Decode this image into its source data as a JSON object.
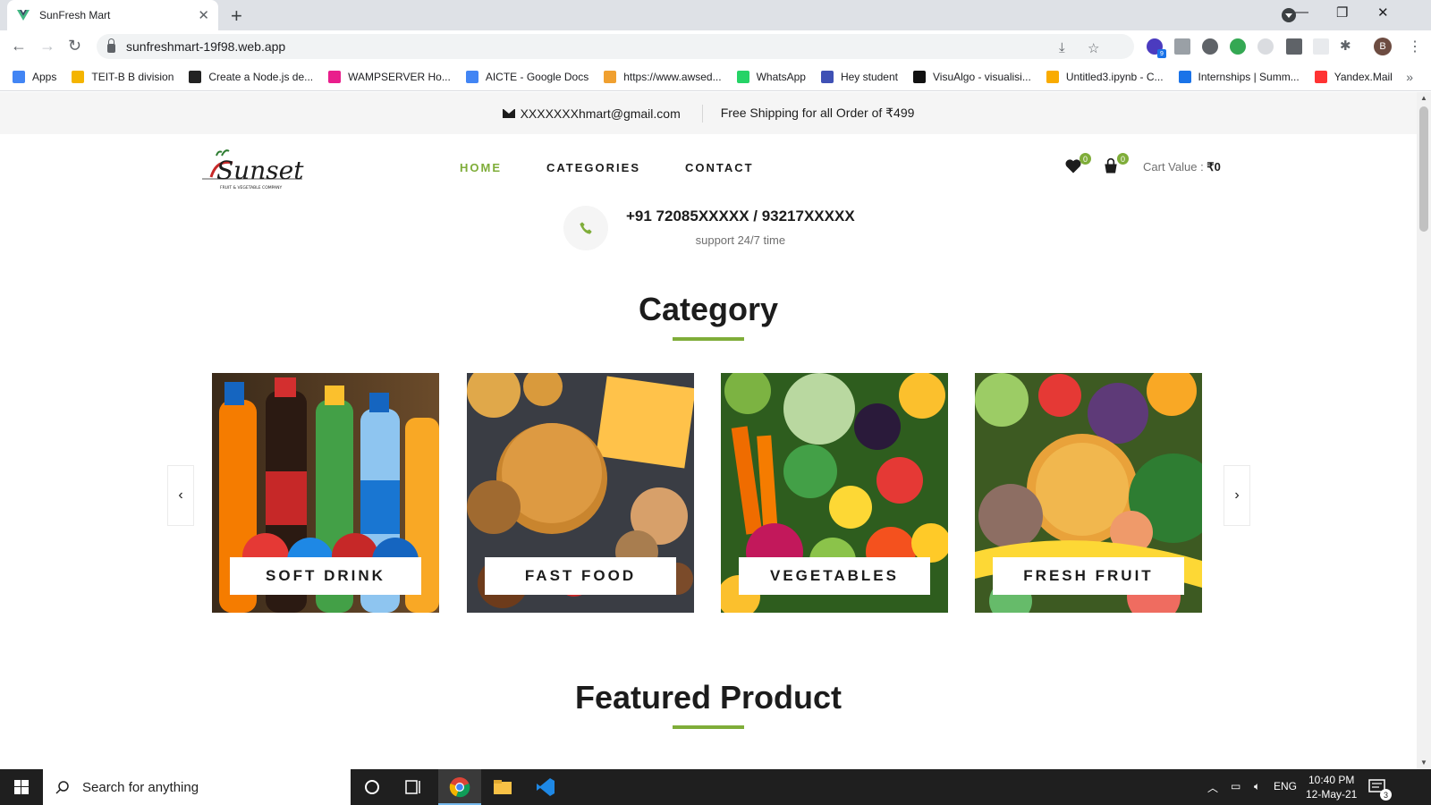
{
  "browser": {
    "tab_title": "SunFresh Mart",
    "url": "sunfreshmart-19f98.web.app",
    "bookmarks": [
      {
        "label": "Apps",
        "color": "#4285f4"
      },
      {
        "label": "TEIT-B B division",
        "color": "#f4b400"
      },
      {
        "label": "Create a Node.js de...",
        "color": "#222222"
      },
      {
        "label": "WAMPSERVER Ho...",
        "color": "#e91e8c"
      },
      {
        "label": "AICTE - Google Docs",
        "color": "#4285f4"
      },
      {
        "label": "https://www.awsed...",
        "color": "#f0a030"
      },
      {
        "label": "WhatsApp",
        "color": "#25d366"
      },
      {
        "label": "Hey student",
        "color": "#3f51b5"
      },
      {
        "label": "VisuAlgo - visualisi...",
        "color": "#111111"
      },
      {
        "label": "Untitled3.ipynb - C...",
        "color": "#f9ab00"
      },
      {
        "label": "Internships | Summ...",
        "color": "#1a73e8"
      },
      {
        "label": "Yandex.Mail",
        "color": "#ff3333"
      }
    ],
    "profile_initial": "B",
    "ext_badge": "9"
  },
  "topbar": {
    "email": "XXXXXXXhmart@gmail.com",
    "shipping": "Free Shipping for all Order of ₹499"
  },
  "header": {
    "logo_text": "Sunset",
    "logo_sub": "FRUIT & VEGETABLE COMPANY",
    "nav": [
      "HOME",
      "CATEGORIES",
      "CONTACT"
    ],
    "wishlist_count": "0",
    "cart_count": "0",
    "cart_label": "Cart Value : ",
    "cart_amount": "₹0"
  },
  "contact": {
    "phone": "+91 72085XXXXX / 93217XXXXX",
    "support": "support 24/7 time"
  },
  "category_section": {
    "title": "Category",
    "items": [
      {
        "label": "SOFT DRINK"
      },
      {
        "label": "FAST FOOD"
      },
      {
        "label": "VEGETABLES"
      },
      {
        "label": "FRESH FRUIT"
      }
    ]
  },
  "featured_section": {
    "title": "Featured Product"
  },
  "colors": {
    "accent": "#7fad39",
    "heading": "#1c1c1c"
  },
  "taskbar": {
    "search_placeholder": "Search for anything",
    "lang": "ENG",
    "time": "10:40 PM",
    "date": "12-May-21",
    "notif_count": "3"
  }
}
